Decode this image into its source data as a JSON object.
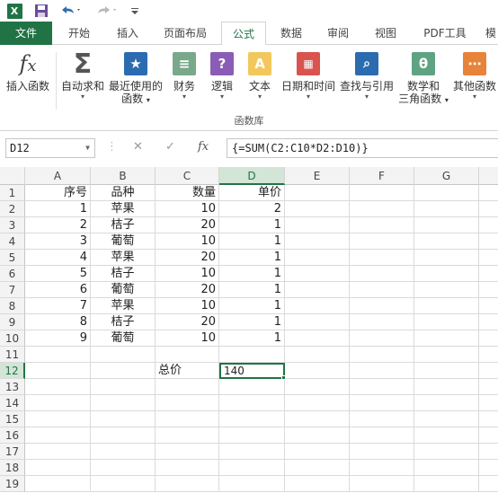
{
  "quick_access": {
    "app_icon": "X",
    "icons": [
      "excel-icon",
      "save-icon",
      "undo-icon",
      "redo-icon",
      "customize-icon"
    ]
  },
  "tabs": [
    "文件",
    "开始",
    "插入",
    "页面布局",
    "公式",
    "数据",
    "审阅",
    "视图",
    "PDF工具",
    "模"
  ],
  "active_tab": "公式",
  "ribbon": {
    "insert_function": "插入函数",
    "autosum": "自动求和",
    "recent_line1": "最近使用的",
    "recent_line2": "函数",
    "financial": "财务",
    "logical": "逻辑",
    "text": "文本",
    "datetime": "日期和时间",
    "lookup": "查找与引用",
    "math_line1": "数学和",
    "math_line2": "三角函数",
    "more": "其他函数",
    "group_label": "函数库",
    "dropdown": "▾"
  },
  "formula_bar": {
    "name_box": "D12",
    "fx": "fx",
    "formula": "{=SUM(C2:C10*D2:D10)}"
  },
  "columns": [
    "A",
    "B",
    "C",
    "D",
    "E",
    "F",
    "G"
  ],
  "selected_column": "D",
  "rows": [
    "1",
    "2",
    "3",
    "4",
    "5",
    "6",
    "7",
    "8",
    "9",
    "10",
    "11",
    "12",
    "13",
    "14",
    "15",
    "16",
    "17",
    "18",
    "19"
  ],
  "selected_row": "12",
  "table": {
    "headers": [
      "序号",
      "品种",
      "数量",
      "单价"
    ],
    "data": [
      [
        "1",
        "苹果",
        "10",
        "2"
      ],
      [
        "2",
        "桔子",
        "20",
        "1"
      ],
      [
        "3",
        "葡萄",
        "10",
        "1"
      ],
      [
        "4",
        "苹果",
        "20",
        "1"
      ],
      [
        "5",
        "桔子",
        "10",
        "1"
      ],
      [
        "6",
        "葡萄",
        "20",
        "1"
      ],
      [
        "7",
        "苹果",
        "10",
        "1"
      ],
      [
        "8",
        "桔子",
        "20",
        "1"
      ],
      [
        "9",
        "葡萄",
        "10",
        "1"
      ]
    ],
    "total_label": "总价",
    "total_value": "140"
  },
  "colors": {
    "excel_green": "#217346",
    "header_bg": "#f3f3f3",
    "selected_header_bg": "#d3e5d6"
  }
}
